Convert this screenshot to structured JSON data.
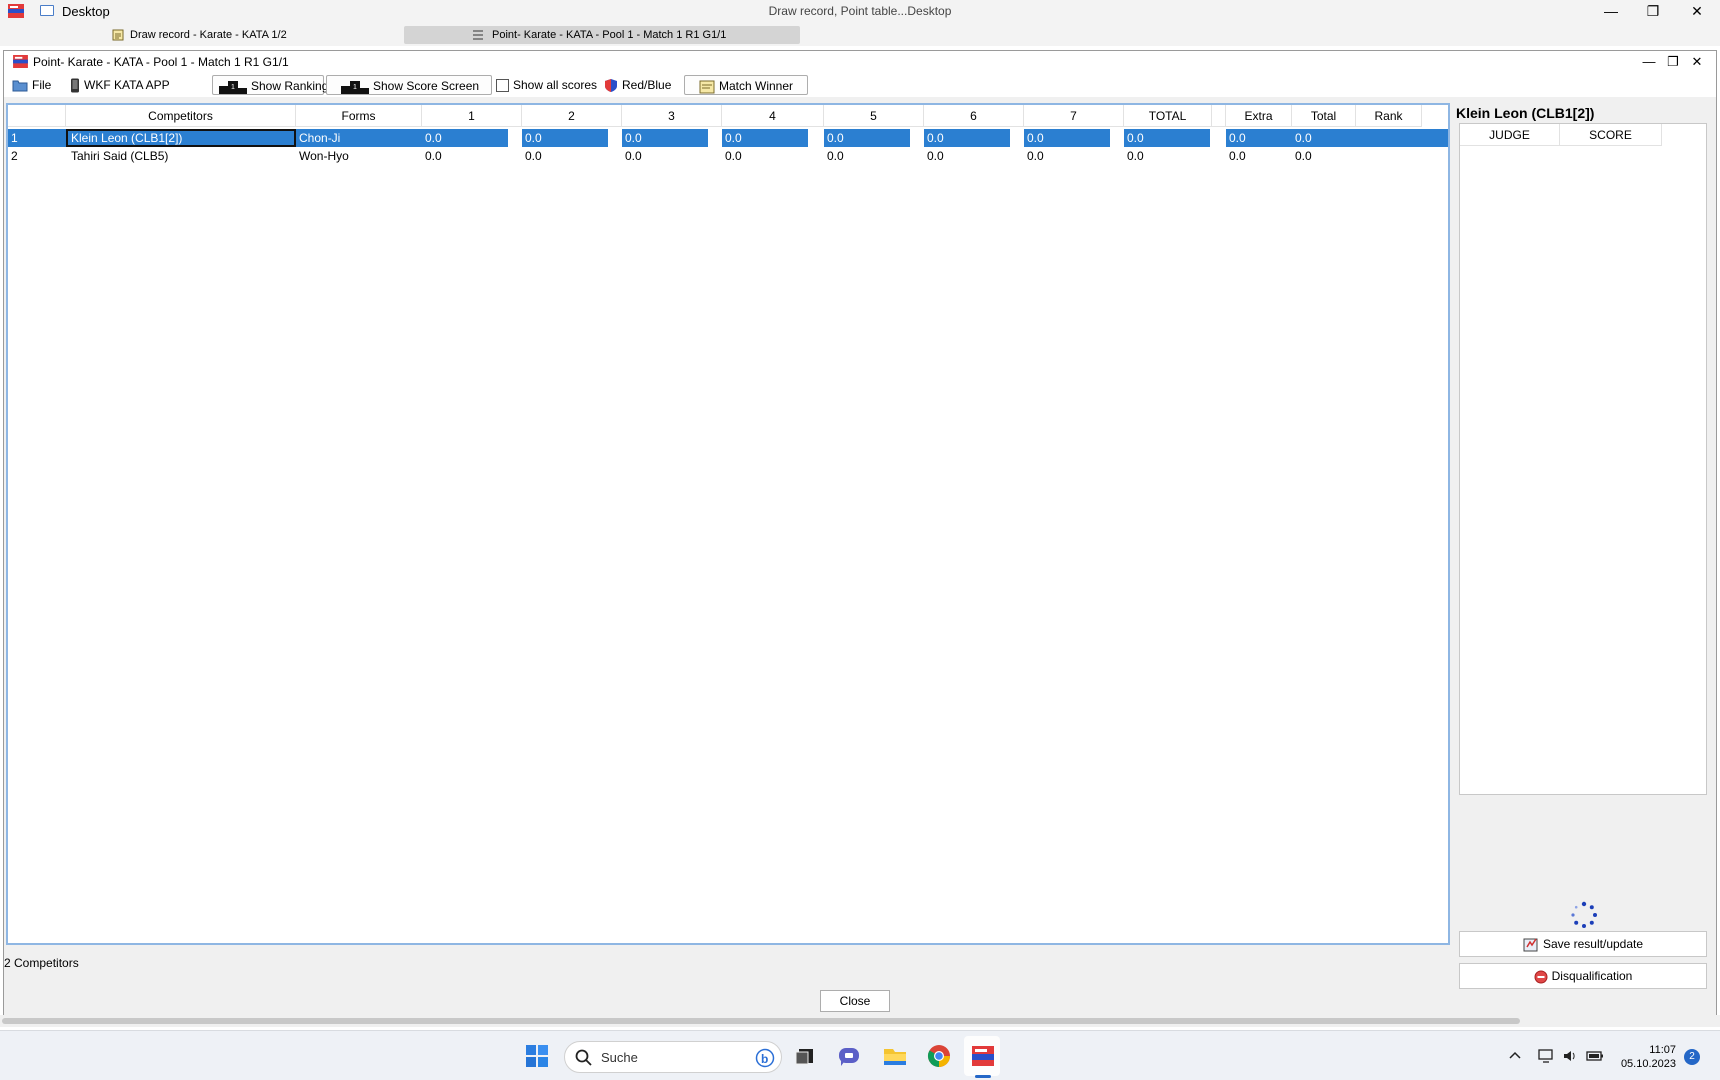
{
  "outer_window": {
    "app_name": "Desktop",
    "center_title": "Draw record, Point table...Desktop",
    "min_symbol": "—",
    "max_symbol": "❐",
    "close_symbol": "✕"
  },
  "tabs": [
    {
      "label": "Draw record - Karate - KATA 1/2",
      "active": false
    },
    {
      "label": "Point- Karate - KATA - Pool 1 - Match 1 R1 G1/1",
      "active": true
    }
  ],
  "inner_window": {
    "title": "Point- Karate - KATA - Pool 1 - Match 1 R1 G1/1",
    "min_symbol": "—",
    "max_symbol": "❐",
    "close_symbol": "✕"
  },
  "toolbar": {
    "file": "File",
    "wkf_app": "WKF KATA APP",
    "show_ranking": "Show Ranking",
    "show_score_screen": "Show Score Screen",
    "show_all_scores": "Show all scores",
    "show_all_scores_checked": false,
    "red_blue": "Red/Blue",
    "match_winner": "Match Winner"
  },
  "grid": {
    "columns": [
      "",
      "Competitors",
      "Forms",
      "1",
      "2",
      "3",
      "4",
      "5",
      "6",
      "7",
      "TOTAL",
      "",
      "Extra",
      "Total",
      "Rank"
    ],
    "rows": [
      {
        "no": "1",
        "competitor": "Klein Leon (CLB1[2])",
        "form": "Chon-Ji",
        "s1": "0.0",
        "s2": "0.0",
        "s3": "0.0",
        "s4": "0.0",
        "s5": "0.0",
        "s6": "0.0",
        "s7": "0.0",
        "total": "0.0",
        "extra": "0.0",
        "total2": "0.0",
        "rank": "",
        "selected": true
      },
      {
        "no": "2",
        "competitor": "Tahiri Said (CLB5)",
        "form": "Won-Hyo",
        "s1": "0.0",
        "s2": "0.0",
        "s3": "0.0",
        "s4": "0.0",
        "s5": "0.0",
        "s6": "0.0",
        "s7": "0.0",
        "total": "0.0",
        "extra": "0.0",
        "total2": "0.0",
        "rank": "",
        "selected": false
      }
    ]
  },
  "right_panel": {
    "competitor": "Klein Leon (CLB1[2])",
    "col_judge": "JUDGE",
    "col_score": "SCORE",
    "save_button": "Save result/update",
    "disqualification_button": "Disqualification"
  },
  "status": "2 Competitors",
  "close_button": "Close",
  "taskbar": {
    "search_placeholder": "Suche",
    "time": "11:07",
    "date": "05.10.2023",
    "notification_count": "2"
  },
  "colors": {
    "selection": "#2b7fd1",
    "grid_border": "#8eb6e3",
    "accent": "#2467c7"
  }
}
